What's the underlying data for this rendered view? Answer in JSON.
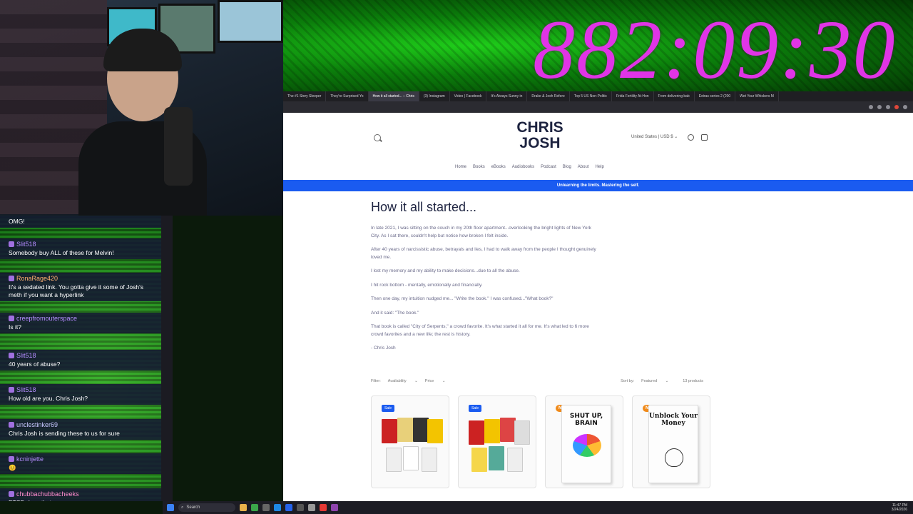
{
  "timer": {
    "text": "882:09:30"
  },
  "browser": {
    "tabs": [
      "The #1 Story Sleeper",
      "They're Surprised Yo",
      "How it all started... – Chris",
      "(3) Instagram",
      "Video | Facebook",
      "It's Always Sunny in",
      "Drake & Josh Refere",
      "Top 5 US Non-Politic",
      "Frida Fertility At-Hon",
      "From delivering bab",
      "Extras series 2 (200",
      "Wet Your Whiskers M"
    ],
    "active_tab_index": 2
  },
  "site": {
    "brand": "CHRIS JOSH",
    "region": "United States | USD $",
    "nav": [
      "Home",
      "Books",
      "eBooks",
      "Audiobooks",
      "Podcast",
      "Blog",
      "About",
      "Help"
    ],
    "announcement": "Unlearning the limits. Mastering the self.",
    "heading": "How it all started...",
    "story": [
      "In late 2021, I was sitting on the couch in my 20th floor apartment...overlooking the bright lights of New York City. As I sat there, couldn't help but notice how broken I felt inside.",
      "After 40 years of narcissistic abuse, betrayals and lies, I had to walk away from the people I thought genuinely loved me.",
      "I lost my memory and my ability to make decisions...due to all the abuse.",
      "I hit rock bottom - mentally, emotionally and financially.",
      "Then one day, my intuition nudged me... \"Write the book.\" I was confused...\"What book?\"",
      "And it said: \"The book.\"",
      "That book is called \"City of Serpents,\" a crowd favorite. It's what started it all for me. It's what led to 6 more crowd favorites and a new life; the rest is history.",
      "- Chris Josh"
    ],
    "filters": {
      "filter_label": "Filter:",
      "availability": "Availability",
      "price": "Price",
      "sort_label": "Sort by:",
      "sort_value": "Featured",
      "count": "13 products"
    },
    "products": [
      {
        "badge": "Sale"
      },
      {
        "badge": "Sale"
      },
      {
        "badge": "NEW",
        "cover_title": "SHUT UP, BRAIN"
      },
      {
        "badge": "NEW",
        "cover_title": "Unblock Your Money"
      }
    ]
  },
  "chat": {
    "messages": [
      {
        "user": "",
        "text": "OMG!"
      },
      {
        "user": "Slit518",
        "text": "Somebody buy ALL of these for Melvin!"
      },
      {
        "user": "RonaRage420",
        "text": "It's a sedated link. You gotta give it some of Josh's meth if you want a hyperlink"
      },
      {
        "user": "creepfromouterspace",
        "text": "Is it?"
      },
      {
        "user": "Slit518",
        "text": "40 years of abuse?"
      },
      {
        "user": "Slit518",
        "text": "How old are you, Chris Josh?"
      },
      {
        "user": "unclestinker69",
        "text": "Chris Josh is sending these to us for sure"
      },
      {
        "user": "kcninjette",
        "text": "😊"
      },
      {
        "user": "chubbachubbacheeks",
        "text": "PTSD does that"
      }
    ]
  },
  "taskbar": {
    "search_placeholder": "Search",
    "time": "11:47 PM",
    "date": "3/24/2026"
  }
}
